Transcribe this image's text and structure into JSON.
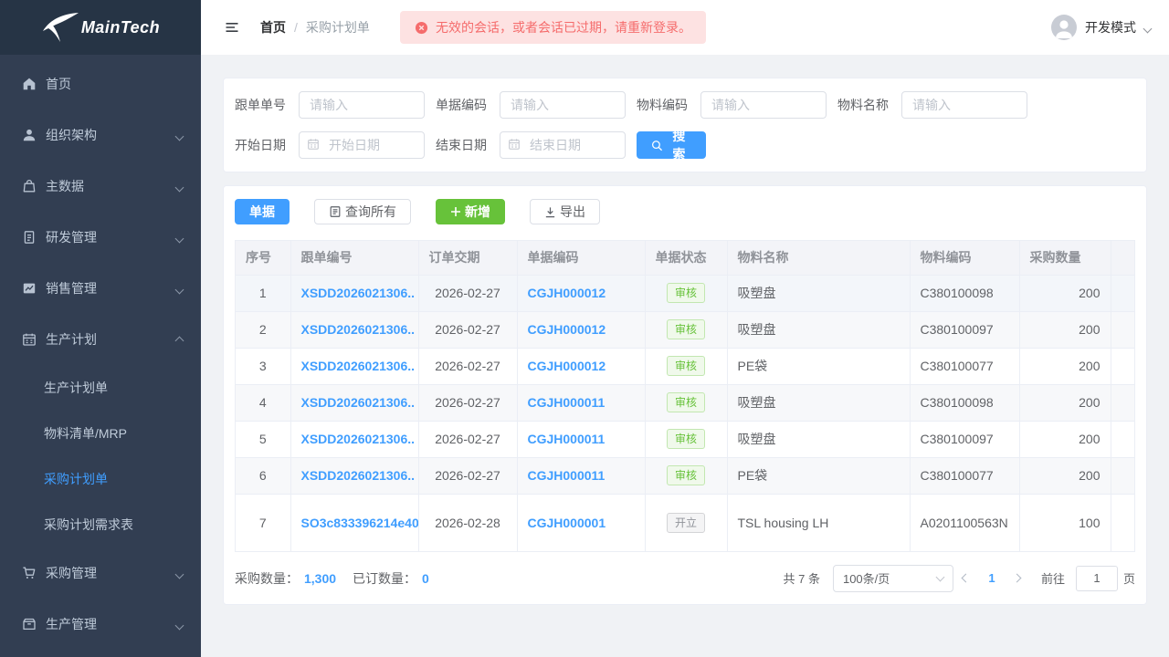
{
  "brand": {
    "name": "MainTech"
  },
  "colors": {
    "accent": "#409eff",
    "success": "#67c23a",
    "danger": "#f56c6c",
    "sidebar_bg": "#323e52",
    "page_bg": "#f0f2f5"
  },
  "topbar": {
    "breadcrumb": {
      "home": "首页",
      "current": "采购计划单"
    },
    "alert": {
      "icon": "error-circle-icon",
      "text": "无效的会话，或者会话已过期，请重新登录。"
    },
    "user": {
      "label": "开发模式"
    }
  },
  "sidebar": {
    "items": [
      {
        "label": "首页",
        "icon": "home-icon"
      },
      {
        "label": "组织架构",
        "icon": "user-icon",
        "chevron": "down"
      },
      {
        "label": "主数据",
        "icon": "bag-icon",
        "chevron": "down"
      },
      {
        "label": "研发管理",
        "icon": "document-icon",
        "chevron": "down"
      },
      {
        "label": "销售管理",
        "icon": "chart-icon",
        "chevron": "down"
      },
      {
        "label": "生产计划",
        "icon": "calendar-icon",
        "chevron": "up",
        "children": [
          {
            "label": "生产计划单",
            "active": false
          },
          {
            "label": "物料清单/MRP",
            "active": false
          },
          {
            "label": "采购计划单",
            "active": true
          },
          {
            "label": "采购计划需求表",
            "active": false
          }
        ]
      },
      {
        "label": "采购管理",
        "icon": "cart-icon",
        "chevron": "down"
      },
      {
        "label": "生产管理",
        "icon": "box-icon",
        "chevron": "down"
      }
    ]
  },
  "search": {
    "fields": [
      {
        "label": "跟单单号",
        "placeholder": "请输入"
      },
      {
        "label": "单据编码",
        "placeholder": "请输入"
      },
      {
        "label": "物料编码",
        "placeholder": "请输入"
      },
      {
        "label": "物料名称",
        "placeholder": "请输入"
      },
      {
        "label": "开始日期",
        "placeholder": "开始日期"
      },
      {
        "label": "结束日期",
        "placeholder": "结束日期"
      }
    ],
    "search_button": "搜索"
  },
  "toolbar": {
    "doc_button": "单据",
    "query_all_button": "查询所有",
    "add_button": "新增",
    "export_button": "导出"
  },
  "table": {
    "columns": [
      "序号",
      "跟单编号",
      "订单交期",
      "单据编码",
      "单据状态",
      "物料名称",
      "物料编码",
      "采购数量"
    ],
    "rows": [
      {
        "seq": "1",
        "order_no": "XSDD2026021306..",
        "delivery_date": "2026-02-27",
        "doc_no": "CGJH000012",
        "status": "审核",
        "material_name": "吸塑盘",
        "material_code": "C380100098",
        "qty": "200"
      },
      {
        "seq": "2",
        "order_no": "XSDD2026021306..",
        "delivery_date": "2026-02-27",
        "doc_no": "CGJH000012",
        "status": "审核",
        "material_name": "吸塑盘",
        "material_code": "C380100097",
        "qty": "200"
      },
      {
        "seq": "3",
        "order_no": "XSDD2026021306..",
        "delivery_date": "2026-02-27",
        "doc_no": "CGJH000012",
        "status": "审核",
        "material_name": "PE袋",
        "material_code": "C380100077",
        "qty": "200"
      },
      {
        "seq": "4",
        "order_no": "XSDD2026021306..",
        "delivery_date": "2026-02-27",
        "doc_no": "CGJH000011",
        "status": "审核",
        "material_name": "吸塑盘",
        "material_code": "C380100098",
        "qty": "200"
      },
      {
        "seq": "5",
        "order_no": "XSDD2026021306..",
        "delivery_date": "2026-02-27",
        "doc_no": "CGJH000011",
        "status": "审核",
        "material_name": "吸塑盘",
        "material_code": "C380100097",
        "qty": "200"
      },
      {
        "seq": "6",
        "order_no": "XSDD2026021306..",
        "delivery_date": "2026-02-27",
        "doc_no": "CGJH000011",
        "status": "审核",
        "material_name": "PE袋",
        "material_code": "C380100077",
        "qty": "200"
      },
      {
        "seq": "7",
        "order_no": "SO3c833396214e40",
        "delivery_date": "2026-02-28",
        "doc_no": "CGJH000001",
        "status": "开立",
        "material_name": "TSL housing LH",
        "material_code": "A0201100563N",
        "qty": "100"
      }
    ]
  },
  "summary": {
    "purchase_qty_label": "采购数量：",
    "purchase_qty": "1,300",
    "ordered_qty_label": "已订数量：",
    "ordered_qty": "0"
  },
  "pagination": {
    "total": "共 7 条",
    "page_size": "100条/页",
    "current_page": "1",
    "goto_label": "前往",
    "goto_value": "1",
    "page_unit": "页"
  }
}
